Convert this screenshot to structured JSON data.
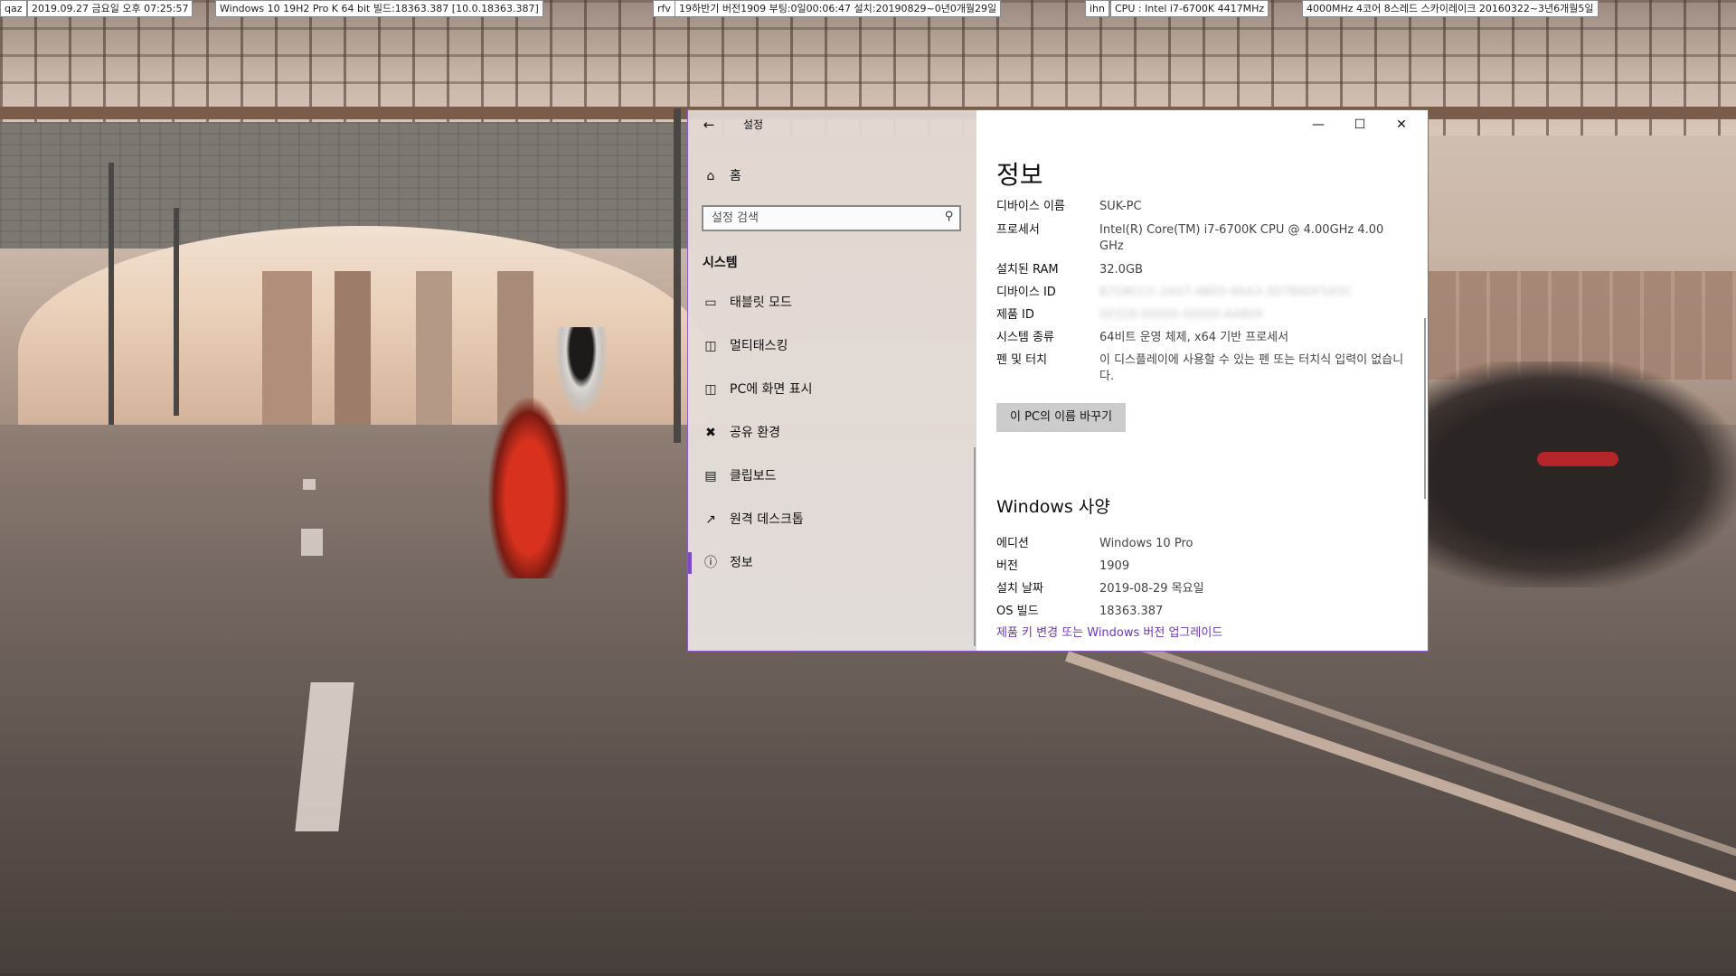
{
  "topbar": {
    "seg1": "qaz",
    "seg2": "2019.09.27 금요일 오후 07:25:57",
    "seg3": "Windows 10 19H2 Pro K 64 bit 빌드:18363.387 [10.0.18363.387]",
    "seg4": "rfv",
    "seg5": "19하반기 버전1909 부팅:0일00:06:47 설치:20190829~0년0개월29일",
    "seg6": "ihn",
    "seg7": "CPU : Intel i7-6700K 4417MHz",
    "seg8": "4000MHz 4코어 8스레드 스카이레이크 20160322~3년6개월5일"
  },
  "window": {
    "title": "설정",
    "home_label": "홈",
    "search_placeholder": "설정 검색",
    "section_label": "시스템",
    "nav_items": [
      {
        "label": "태블릿 모드",
        "icon": "tablet-mode-icon"
      },
      {
        "label": "멀티태스킹",
        "icon": "multitasking-icon"
      },
      {
        "label": "PC에 화면 표시",
        "icon": "project-to-pc-icon"
      },
      {
        "label": "공유 환경",
        "icon": "shared-experiences-icon"
      },
      {
        "label": "클립보드",
        "icon": "clipboard-icon"
      },
      {
        "label": "원격 데스크톱",
        "icon": "remote-desktop-icon"
      },
      {
        "label": "정보",
        "icon": "info-icon",
        "active": true
      }
    ]
  },
  "about": {
    "page_title": "정보",
    "device_name_label": "디바이스 이름",
    "device_name_value": "SUK-PC",
    "processor_label": "프로세서",
    "processor_value": "Intel(R) Core(TM) i7-6700K CPU @ 4.00GHz   4.00 GHz",
    "ram_label": "설치된 RAM",
    "ram_value": "32.0GB",
    "device_id_label": "디바이스 ID",
    "device_id_value": "B7D8CCC-2A07-4BE0-9AA3-3D7B6DF5A5C",
    "product_id_label": "제품 ID",
    "product_id_value": "00328-00000-00000-AA809",
    "system_type_label": "시스템 종류",
    "system_type_value": "64비트 운영 체제, x64 기반 프로세서",
    "pen_label": "펜 및 터치",
    "pen_value": "이 디스플레이에 사용할 수 있는 펜 또는 터치식 입력이 없습니다.",
    "rename_button": "이 PC의 이름 바꾸기",
    "spec_title": "Windows 사양",
    "edition_label": "에디션",
    "edition_value": "Windows 10 Pro",
    "version_label": "버전",
    "version_value": "1909",
    "install_date_label": "설치 날짜",
    "install_date_value": "2019-08-29 목요일",
    "os_build_label": "OS 빌드",
    "os_build_value": "18363.387",
    "upgrade_link": "제품 키 변경 또는 Windows 버전 업그레이드"
  },
  "colors": {
    "accent": "#7b4cc4",
    "link": "#6b36b8",
    "window_border": "#8b5cc8"
  }
}
